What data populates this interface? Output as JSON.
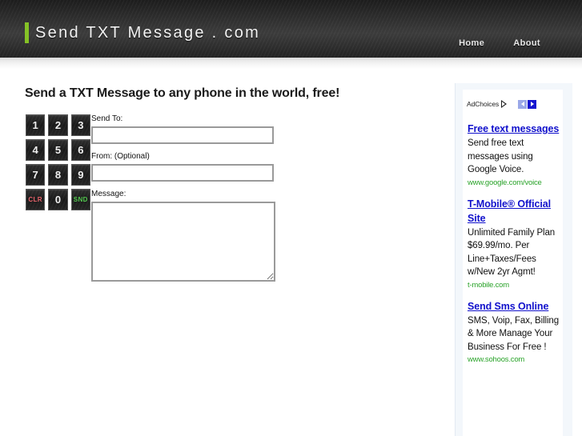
{
  "header": {
    "brand": "Send TXT Message . com",
    "nav": [
      {
        "label": "Home"
      },
      {
        "label": "About"
      }
    ]
  },
  "main": {
    "title": "Send a TXT Message to any phone in the world, free!",
    "keypad": {
      "rows": [
        [
          {
            "label": "1",
            "kind": "digit"
          },
          {
            "label": "2",
            "kind": "digit"
          },
          {
            "label": "3",
            "kind": "digit"
          }
        ],
        [
          {
            "label": "4",
            "kind": "digit"
          },
          {
            "label": "5",
            "kind": "digit"
          },
          {
            "label": "6",
            "kind": "digit"
          }
        ],
        [
          {
            "label": "7",
            "kind": "digit"
          },
          {
            "label": "8",
            "kind": "digit"
          },
          {
            "label": "9",
            "kind": "digit"
          }
        ],
        [
          {
            "label": "CLR",
            "kind": "clear"
          },
          {
            "label": "0",
            "kind": "digit"
          },
          {
            "label": "SND",
            "kind": "send"
          }
        ]
      ],
      "clear_color": "#e8636b",
      "send_color": "#53c94f"
    },
    "form": {
      "send_to": {
        "label": "Send To:",
        "value": "",
        "placeholder": ""
      },
      "from": {
        "label": "From: (Optional)",
        "value": "",
        "placeholder": ""
      },
      "message": {
        "label": "Message:",
        "value": "",
        "placeholder": ""
      }
    }
  },
  "sidebar": {
    "adchoices": {
      "label": "AdChoices",
      "prev_arrow": "left-arrow-icon",
      "next_arrow": "right-arrow-icon"
    },
    "ads": [
      {
        "title": "Free text messages",
        "description": "Send free text messages using Google Voice.",
        "url": "www.google.com/voice"
      },
      {
        "title": "T-Mobile® Official Site",
        "description": "Unlimited Family Plan $69.99/mo. Per Line+Taxes/Fees w/New 2yr Agmt!",
        "url": "t-mobile.com"
      },
      {
        "title": "Send Sms Online",
        "description": "SMS, Voip, Fax, Billing & More Manage Your Business For Free !",
        "url": "www.sohoos.com"
      }
    ]
  },
  "colors": {
    "brand_accent": "#85c226",
    "header_dark": "#2c2c2c",
    "ad_link": "#1111cc",
    "ad_url": "#2aa32a",
    "page_bg": "#ffffff"
  }
}
